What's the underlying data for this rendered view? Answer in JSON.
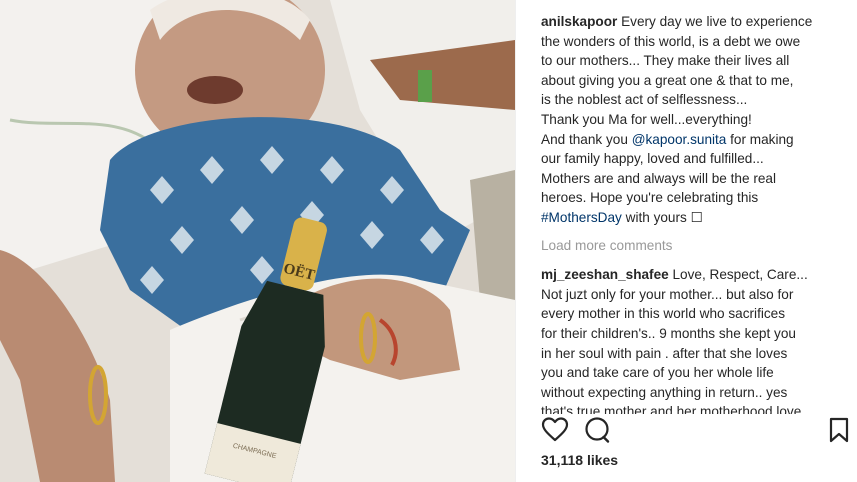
{
  "photo": {
    "alt_label": "",
    "bottle_label": "OËT",
    "bottle_sub_label": "CHAMPAGNE"
  },
  "caption": {
    "username": "anilskapoor",
    "lines": [
      " Every day we live to experience",
      "the wonders of this world, is a debt we owe",
      "to our mothers... They make their lives all",
      "about giving you a great one & that to me,",
      "is the noblest act of selflessness...",
      "Thank you Ma for well...everything!"
    ],
    "thanks_prefix": "And thank you ",
    "mention": "@kapoor.sunita",
    "thanks_suffix": " for making",
    "lines2": [
      "our family happy, loved and fulfilled...",
      "Mothers are and always will be the real",
      "heroes. Hope you're celebrating this"
    ],
    "hashtag": "#MothersDay",
    "hashtag_suffix": " with yours ☐"
  },
  "load_more": "Load more comments",
  "comment": {
    "username": "mj_zeeshan_shafee",
    "lines": [
      " Love, Respect, Care...",
      "Not juzt only for your mother... but also for",
      "every mother in this world who sacrifices",
      "for their children's.. 9 months she kept you",
      "in her soul with pain . after that she loves",
      "you and take care of you her whole life",
      "without expecting anything in return.. yes",
      "that's true mother and her motherhood love"
    ]
  },
  "actions": {
    "like_icon": "heart-icon",
    "comment_icon": "comment-icon",
    "save_icon": "bookmark-icon"
  },
  "likes": "31,118 likes",
  "colors": {
    "link": "#003569",
    "muted": "#999999",
    "text": "#262626"
  }
}
